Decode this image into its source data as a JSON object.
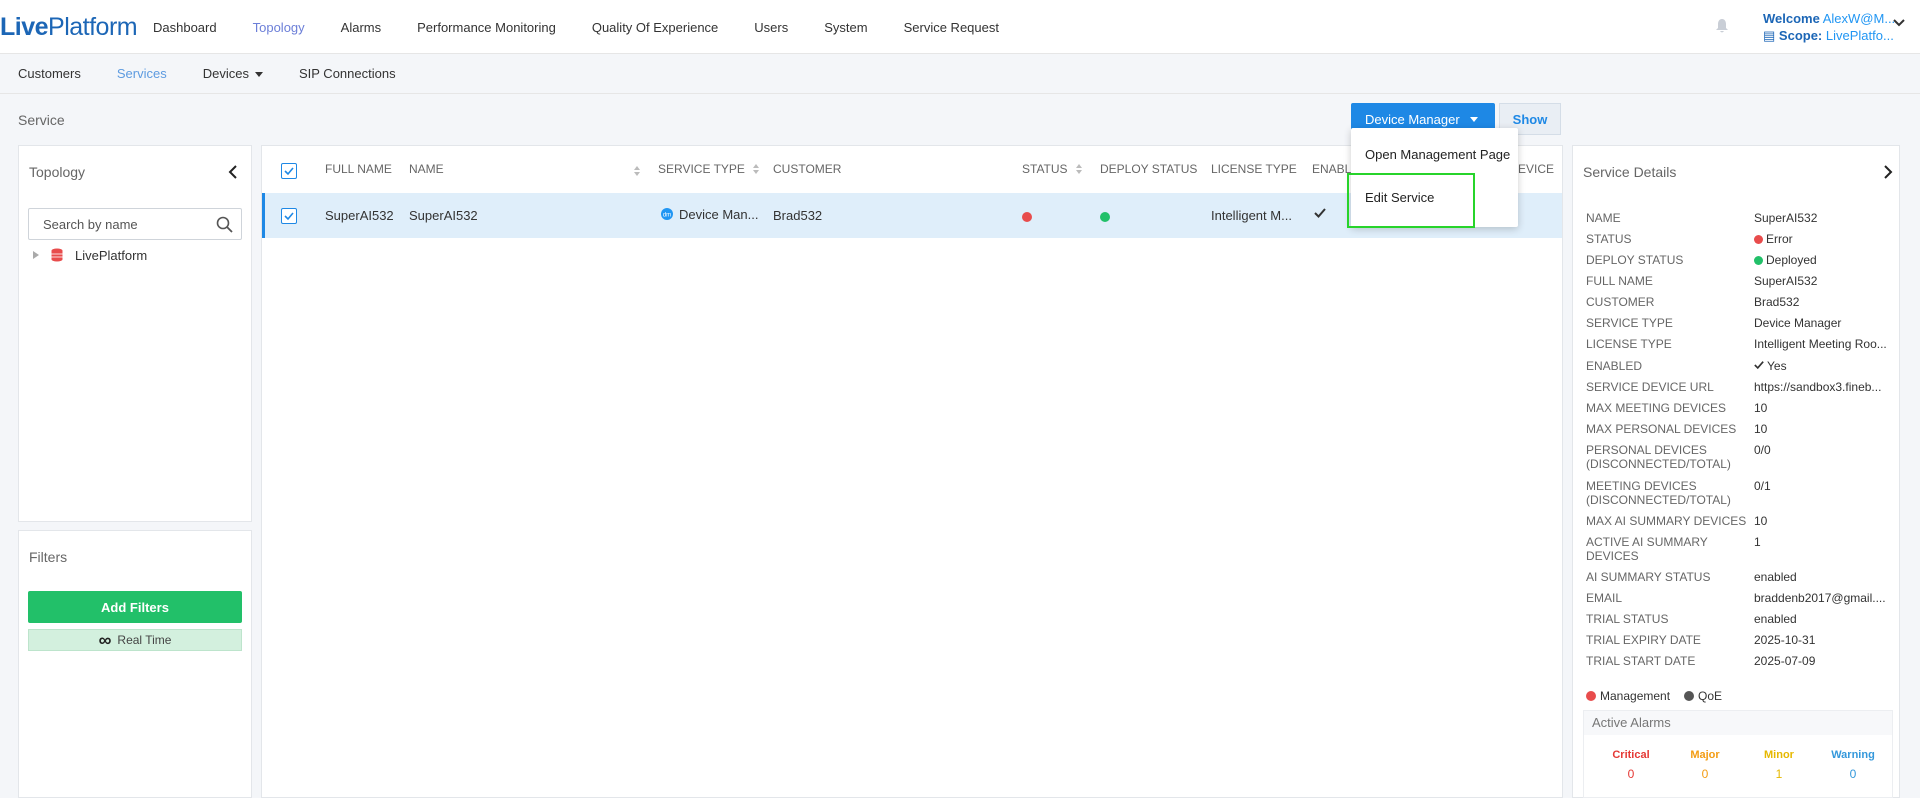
{
  "app": {
    "logo_live": "Live",
    "logo_platform": "Platform",
    "nav": [
      "Dashboard",
      "Topology",
      "Alarms",
      "Performance Monitoring",
      "Quality Of Experience",
      "Users",
      "System",
      "Service Request"
    ],
    "nav_active": "Topology",
    "user": {
      "welcome_label": "Welcome",
      "welcome_value": "AlexW@M...",
      "scope_label": "Scope:",
      "scope_value": "LivePlatfo..."
    }
  },
  "subnav": {
    "items": [
      "Customers",
      "Services",
      "Devices",
      "SIP Connections"
    ],
    "active": "Services"
  },
  "page": {
    "title": "Service",
    "device_manager_button": "Device Manager",
    "show_button": "Show"
  },
  "dropdown": {
    "options": [
      "Open Management Page",
      "Edit Service"
    ]
  },
  "topology": {
    "title": "Topology",
    "search_placeholder": "Search by name",
    "tree_root": "LivePlatform"
  },
  "filters": {
    "title": "Filters",
    "add_button": "Add Filters",
    "realtime": "Real Time"
  },
  "table": {
    "columns": [
      "FULL NAME",
      "NAME",
      "SERVICE TYPE",
      "CUSTOMER",
      "STATUS",
      "DEPLOY STATUS",
      "LICENSE TYPE",
      "ENABL",
      "EVICE"
    ],
    "rows": [
      {
        "full_name": "SuperAI532",
        "name": "SuperAI532",
        "service_type": "Device Man...",
        "customer": "Brad532",
        "license_type": "Intelligent M..."
      }
    ]
  },
  "details": {
    "title": "Service Details",
    "rows": [
      {
        "key": "NAME",
        "value": "SuperAI532"
      },
      {
        "key": "STATUS",
        "value": "Error"
      },
      {
        "key": "DEPLOY STATUS",
        "value": "Deployed"
      },
      {
        "key": "FULL NAME",
        "value": "SuperAI532"
      },
      {
        "key": "CUSTOMER",
        "value": "Brad532"
      },
      {
        "key": "SERVICE TYPE",
        "value": "Device Manager"
      },
      {
        "key": "LICENSE TYPE",
        "value": "Intelligent Meeting Roo..."
      },
      {
        "key": "ENABLED",
        "value": "Yes"
      },
      {
        "key": "SERVICE DEVICE URL",
        "value": "https://sandbox3.fineb..."
      },
      {
        "key": "MAX MEETING DEVICES",
        "value": "10"
      },
      {
        "key": "MAX PERSONAL DEVICES",
        "value": "10"
      },
      {
        "key": "PERSONAL DEVICES (DISCONNECTED/TOTAL)",
        "value": "0/0"
      },
      {
        "key": "MEETING DEVICES (DISCONNECTED/TOTAL)",
        "value": "0/1"
      },
      {
        "key": "MAX AI SUMMARY DEVICES",
        "value": "10"
      },
      {
        "key": "ACTIVE AI SUMMARY DEVICES",
        "value": "1"
      },
      {
        "key": "AI SUMMARY STATUS",
        "value": "enabled"
      },
      {
        "key": "EMAIL",
        "value": "braddenb2017@gmail...."
      },
      {
        "key": "TRIAL STATUS",
        "value": "enabled"
      },
      {
        "key": "TRIAL EXPIRY DATE",
        "value": "2025-10-31"
      },
      {
        "key": "TRIAL START DATE",
        "value": "2025-07-09"
      }
    ],
    "legend": {
      "management": "Management",
      "qoe": "QoE"
    },
    "active_alarms": {
      "title": "Active Alarms",
      "levels": [
        {
          "name": "Critical",
          "count": "0",
          "color": "#e53935"
        },
        {
          "name": "Major",
          "count": "0",
          "color": "#f39c12"
        },
        {
          "name": "Minor",
          "count": "1",
          "color": "#e6b800"
        },
        {
          "name": "Warning",
          "count": "0",
          "color": "#3498db"
        }
      ]
    }
  },
  "colors": {
    "primary": "#1e88e5",
    "error": "#e84c4c",
    "ok": "#22c069",
    "highlight": "#27d42a"
  }
}
